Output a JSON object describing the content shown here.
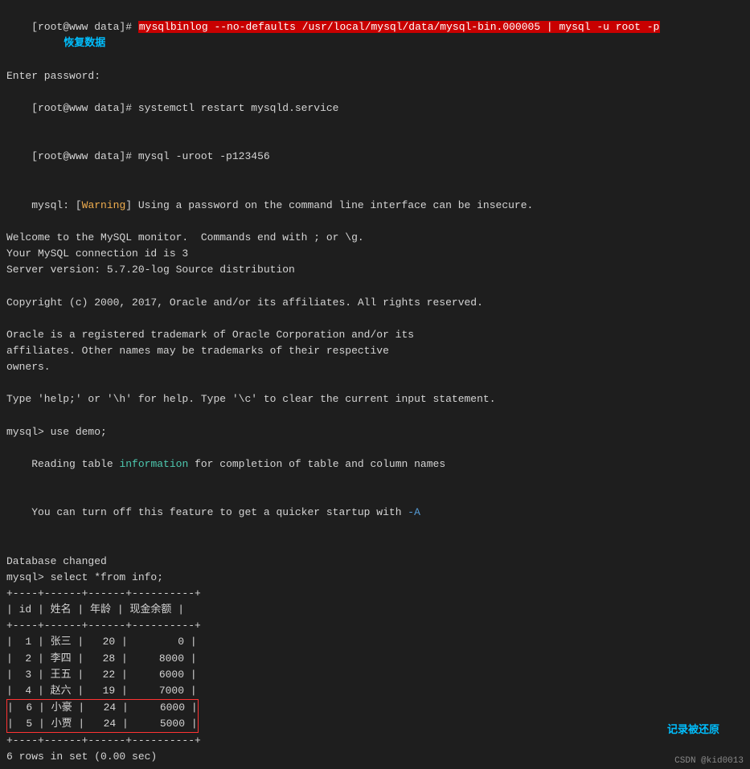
{
  "terminal": {
    "lines": [
      {
        "id": "line1",
        "type": "prompt-command",
        "prompt": "[root@www data]# ",
        "command": "mysqlbinlog --no-defaults /usr/local/mysql/data/mysql-bin.000005 | mysql -u root -p",
        "highlighted": true
      },
      {
        "id": "line2",
        "type": "plain",
        "text": "Enter password:"
      },
      {
        "id": "line3",
        "type": "prompt-plain",
        "prompt": "[root@www data]# ",
        "text": "systemctl restart mysqld.service"
      },
      {
        "id": "line4",
        "type": "prompt-plain",
        "prompt": "[root@www data]# ",
        "text": "mysql -uroot -p123456"
      },
      {
        "id": "line5",
        "type": "warning",
        "prefix": "mysql: [",
        "warning": "Warning",
        "suffix": "] Using a password on the command line interface can be insecure."
      },
      {
        "id": "line6",
        "type": "plain",
        "text": "Welcome to the MySQL monitor.  Commands end with ; or \\g."
      },
      {
        "id": "line7",
        "type": "plain",
        "text": "Your MySQL connection id is 3"
      },
      {
        "id": "line8",
        "type": "plain",
        "text": "Server version: 5.7.20-log Source distribution"
      },
      {
        "id": "line9",
        "type": "plain",
        "text": ""
      },
      {
        "id": "line10",
        "type": "plain",
        "text": "Copyright (c) 2000, 2017, Oracle and/or its affiliates. All rights reserved."
      },
      {
        "id": "line11",
        "type": "plain",
        "text": ""
      },
      {
        "id": "line12",
        "type": "plain",
        "text": "Oracle is a registered trademark of Oracle Corporation and/or its"
      },
      {
        "id": "line13",
        "type": "plain-other",
        "text": "affiliates. Other names may be trademarks of their respective"
      },
      {
        "id": "line14",
        "type": "plain",
        "text": "owners."
      },
      {
        "id": "line15",
        "type": "plain",
        "text": ""
      },
      {
        "id": "line16",
        "type": "plain",
        "text": "Type 'help;' or '\\h' for help. Type '\\c' to clear the current input statement."
      },
      {
        "id": "line17",
        "type": "plain",
        "text": ""
      },
      {
        "id": "line18",
        "type": "plain",
        "text": "mysql> use demo;"
      },
      {
        "id": "line19",
        "type": "info",
        "before": "Reading table ",
        "info": "information",
        "after": " for completion of table and column names"
      },
      {
        "id": "line20",
        "type": "plain-dash",
        "text": "You can turn off this feature to get a quicker startup with ",
        "dash": "-A"
      },
      {
        "id": "line21",
        "type": "plain",
        "text": ""
      },
      {
        "id": "line22",
        "type": "plain",
        "text": "Database changed"
      },
      {
        "id": "line23",
        "type": "plain",
        "text": "mysql> select *from info;"
      },
      {
        "id": "line24",
        "type": "table",
        "text": "+----+------+------+----------+"
      },
      {
        "id": "line25",
        "type": "table",
        "text": "| id | 姓名 | 年龄 | 现金余额 |"
      },
      {
        "id": "line26",
        "type": "table",
        "text": "+----+------+------+----------+"
      },
      {
        "id": "line27",
        "type": "table",
        "text": "|  1 | 张三 |   20 |        0 |"
      },
      {
        "id": "line28",
        "type": "table",
        "text": "|  2 | 李四 |   28 |     8000 |"
      },
      {
        "id": "line29",
        "type": "table",
        "text": "|  3 | 王五 |   22 |     6000 |"
      },
      {
        "id": "line30",
        "type": "table",
        "text": "|  4 | 赵六 |   19 |     7000 |"
      },
      {
        "id": "line31",
        "type": "table-boxed",
        "text": "|  6 | 小豪 |   24 |     6000 |"
      },
      {
        "id": "line32",
        "type": "table-boxed",
        "text": "|  5 | 小贾 |   24 |     5000 |"
      },
      {
        "id": "line33",
        "type": "table",
        "text": "+----+------+------+----------+"
      },
      {
        "id": "line34",
        "type": "plain",
        "text": "6 rows in set (0.00 sec)"
      }
    ],
    "annotations": {
      "huifu": "恢复数据",
      "jilu": "记录被还原"
    },
    "watermark": "CSDN @kid0013"
  }
}
